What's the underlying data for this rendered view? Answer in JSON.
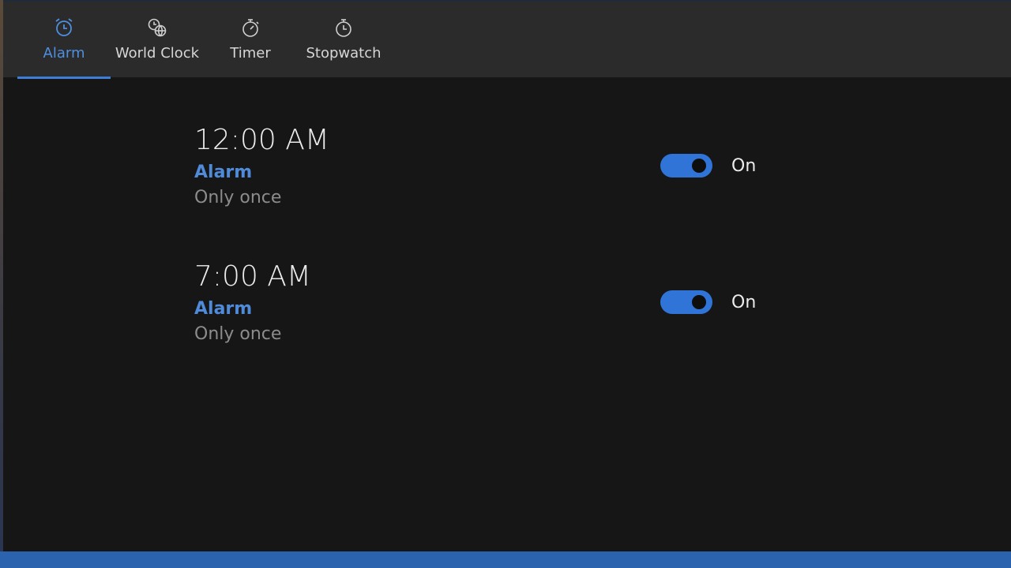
{
  "nav": {
    "tabs": [
      {
        "label": "Alarm",
        "icon": "alarm-clock-icon",
        "active": true
      },
      {
        "label": "World Clock",
        "icon": "world-clock-icon",
        "active": false
      },
      {
        "label": "Timer",
        "icon": "timer-icon",
        "active": false
      },
      {
        "label": "Stopwatch",
        "icon": "stopwatch-icon",
        "active": false
      }
    ]
  },
  "alarms": [
    {
      "time": "12:00 AM",
      "name": "Alarm",
      "repeat": "Only once",
      "state": "On",
      "enabled": true
    },
    {
      "time": "7:00 AM",
      "name": "Alarm",
      "repeat": "Only once",
      "state": "On",
      "enabled": true
    }
  ],
  "colors": {
    "accent": "#3d7fd8",
    "background": "#161616",
    "nav_background": "#2b2b2b",
    "taskbar": "#2b63ae"
  }
}
